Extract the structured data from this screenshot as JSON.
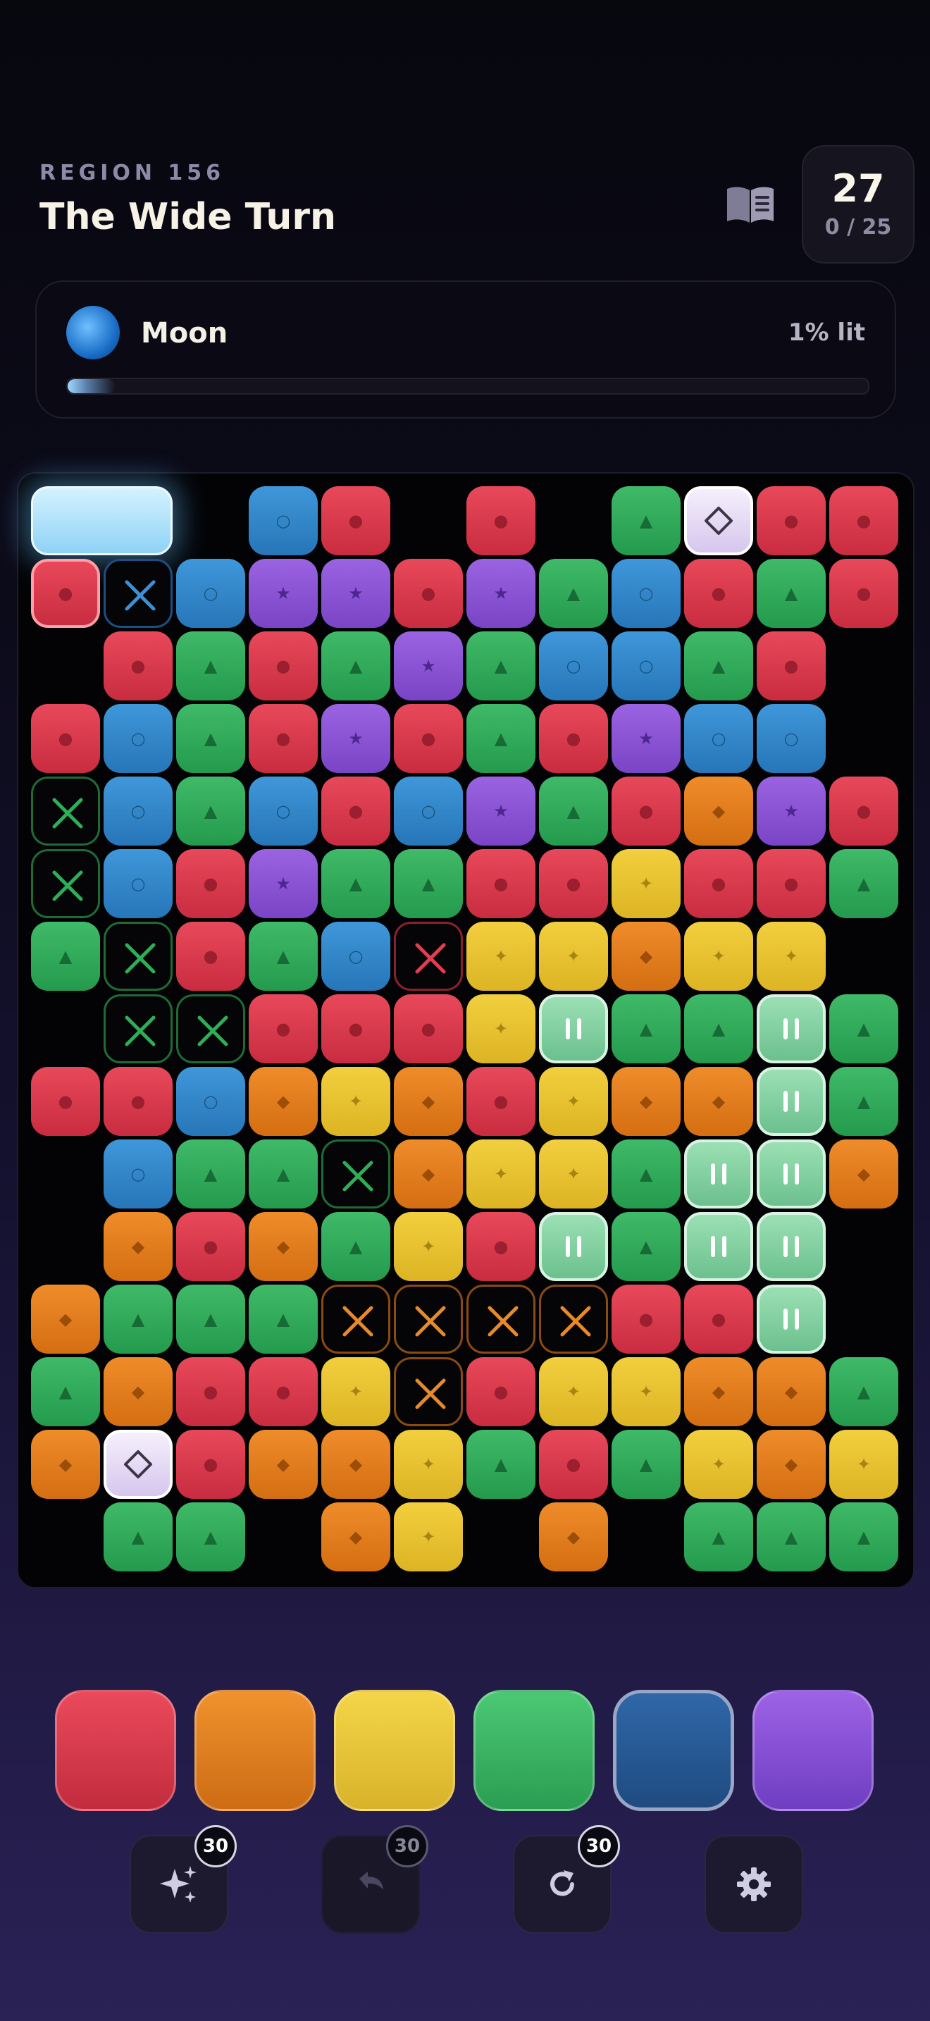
{
  "header": {
    "region_label": "REGION 156",
    "level_title": "The Wide Turn",
    "score": "27",
    "moves": "0 / 25"
  },
  "goal": {
    "name": "Moon",
    "percent_label": "1% lit",
    "progress_fraction": 0.01
  },
  "board": {
    "legend": {
      "R": "red",
      "O": "orange",
      "Y": "yellow",
      "G": "green",
      "B": "blue",
      "P": "purple",
      "S": "start-tile-lit",
      "D": "diamond-gem",
      "H": "paused-tile",
      "xg": "blocker-green",
      "xb": "blocker-blue",
      "xr": "blocker-red",
      "xo": "blocker-orange",
      "_": "empty"
    },
    "rows": [
      [
        "S",
        "S",
        "_",
        "B",
        "R",
        "_",
        "R",
        "_",
        "G",
        "D",
        "R",
        "R"
      ],
      [
        "R*",
        "xb",
        "B",
        "P",
        "P",
        "R",
        "P",
        "G",
        "B",
        "R",
        "G",
        "R"
      ],
      [
        "_",
        "R",
        "G",
        "R",
        "G",
        "P",
        "G",
        "B",
        "B",
        "G",
        "R",
        "_"
      ],
      [
        "R",
        "B",
        "G",
        "R",
        "P",
        "R",
        "G",
        "R",
        "P",
        "B",
        "B",
        "_"
      ],
      [
        "xg",
        "B",
        "G",
        "B",
        "R",
        "B",
        "P",
        "G",
        "R",
        "O",
        "P",
        "R"
      ],
      [
        "xg",
        "B",
        "R",
        "P",
        "G",
        "G",
        "R",
        "R",
        "Y",
        "R",
        "R",
        "G"
      ],
      [
        "G",
        "xg",
        "R",
        "G",
        "B",
        "xr",
        "Y",
        "Y",
        "O",
        "Y",
        "Y",
        "_"
      ],
      [
        "_",
        "xg",
        "xg",
        "R",
        "R",
        "R",
        "Y",
        "H",
        "G",
        "G",
        "H",
        "G"
      ],
      [
        "R",
        "R",
        "B",
        "O",
        "Y",
        "O",
        "R",
        "Y",
        "O",
        "O",
        "H",
        "G"
      ],
      [
        "_",
        "B",
        "G",
        "G",
        "xg",
        "O",
        "Y",
        "Y",
        "G",
        "H",
        "H",
        "O"
      ],
      [
        "_",
        "O",
        "R",
        "O",
        "G",
        "Y",
        "R",
        "H",
        "G",
        "H",
        "H",
        "_"
      ],
      [
        "O",
        "G",
        "G",
        "G",
        "xo",
        "xo",
        "xo",
        "xo",
        "R",
        "R",
        "H",
        "_"
      ],
      [
        "G",
        "O",
        "R",
        "R",
        "Y",
        "xo",
        "R",
        "Y",
        "Y",
        "O",
        "O",
        "G"
      ],
      [
        "O",
        "D",
        "R",
        "O",
        "O",
        "Y",
        "G",
        "R",
        "G",
        "Y",
        "O",
        "Y"
      ],
      [
        "_",
        "G",
        "G",
        "_",
        "O",
        "Y",
        "_",
        "O",
        "_",
        "G",
        "G",
        "G"
      ]
    ]
  },
  "palette": [
    "red",
    "orange",
    "yellow",
    "green",
    "blue",
    "purple"
  ],
  "palette_selected": "blue",
  "tools": [
    {
      "name": "hint",
      "icon": "sparkle-icon",
      "count": "30",
      "enabled": true
    },
    {
      "name": "undo",
      "icon": "undo-icon",
      "count": "30",
      "enabled": false
    },
    {
      "name": "restart",
      "icon": "refresh-icon",
      "count": "30",
      "enabled": true
    },
    {
      "name": "settings",
      "icon": "gear-icon",
      "enabled": true
    }
  ],
  "colors": {
    "red": "#e23d50",
    "orange": "#e7801e",
    "yellow": "#ecc835",
    "green": "#35b05f",
    "blue": "#3388cc",
    "purple": "#8d55d6",
    "background": "#0c0b1a"
  }
}
